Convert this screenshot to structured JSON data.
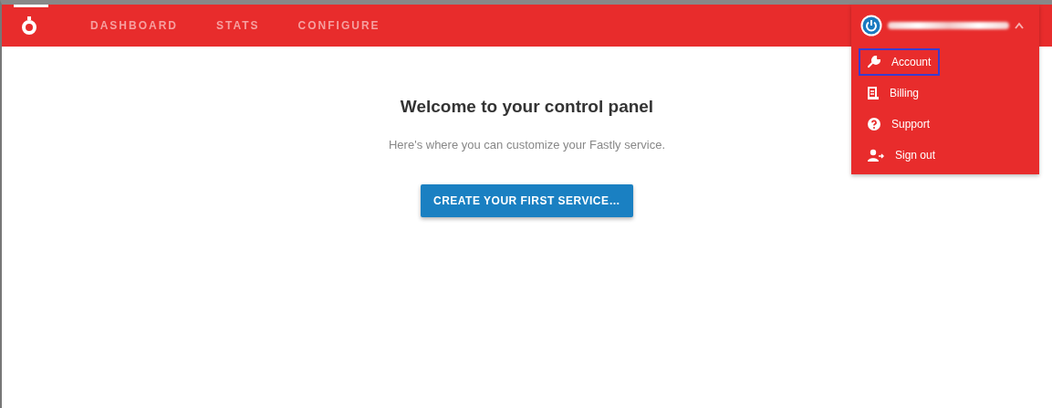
{
  "navbar": {
    "items": [
      {
        "label": "DASHBOARD",
        "selected": false
      },
      {
        "label": "STATS",
        "selected": false
      },
      {
        "label": "CONFIGURE",
        "selected": false
      }
    ]
  },
  "user_menu": {
    "expanded": true,
    "items": [
      {
        "label": "Account",
        "kind": "wrench",
        "highlighted": true
      },
      {
        "label": "Billing",
        "kind": "billing",
        "highlighted": false
      },
      {
        "label": "Support",
        "kind": "help",
        "highlighted": false
      },
      {
        "label": "Sign out",
        "kind": "signout",
        "highlighted": false
      }
    ]
  },
  "main": {
    "title": "Welcome to your control panel",
    "subtitle": "Here's where you can customize your Fastly service.",
    "button": "CREATE YOUR FIRST SERVICE…"
  }
}
